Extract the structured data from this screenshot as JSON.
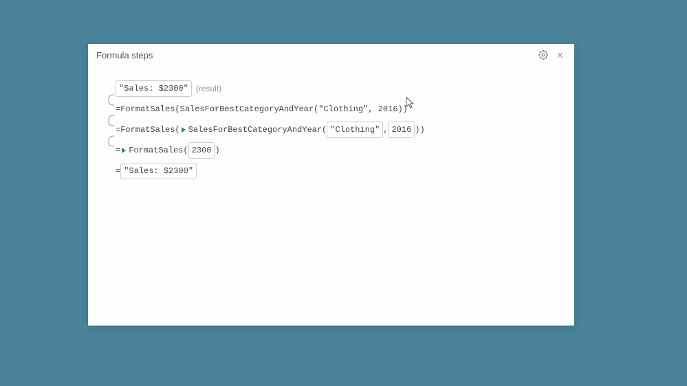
{
  "header": {
    "title": "Formula steps"
  },
  "result": {
    "value": "\"Sales: $2300\"",
    "label": "(result)"
  },
  "step1": {
    "text": "=FormatSales(SalesForBestCategoryAndYear(\"Clothing\", 2016))"
  },
  "step2": {
    "prefix": "=FormatSales( ",
    "func": " SalesForBestCategoryAndYear(",
    "arg1": "\"Clothing\"",
    "comma": ", ",
    "arg2": "2016",
    "close": ") ",
    "suffix": " )"
  },
  "step3": {
    "prefix": "= ",
    "func": " FormatSales(",
    "arg": "2300",
    "close": ")"
  },
  "step4": {
    "prefix": "= ",
    "value": "\"Sales: $2300\""
  }
}
